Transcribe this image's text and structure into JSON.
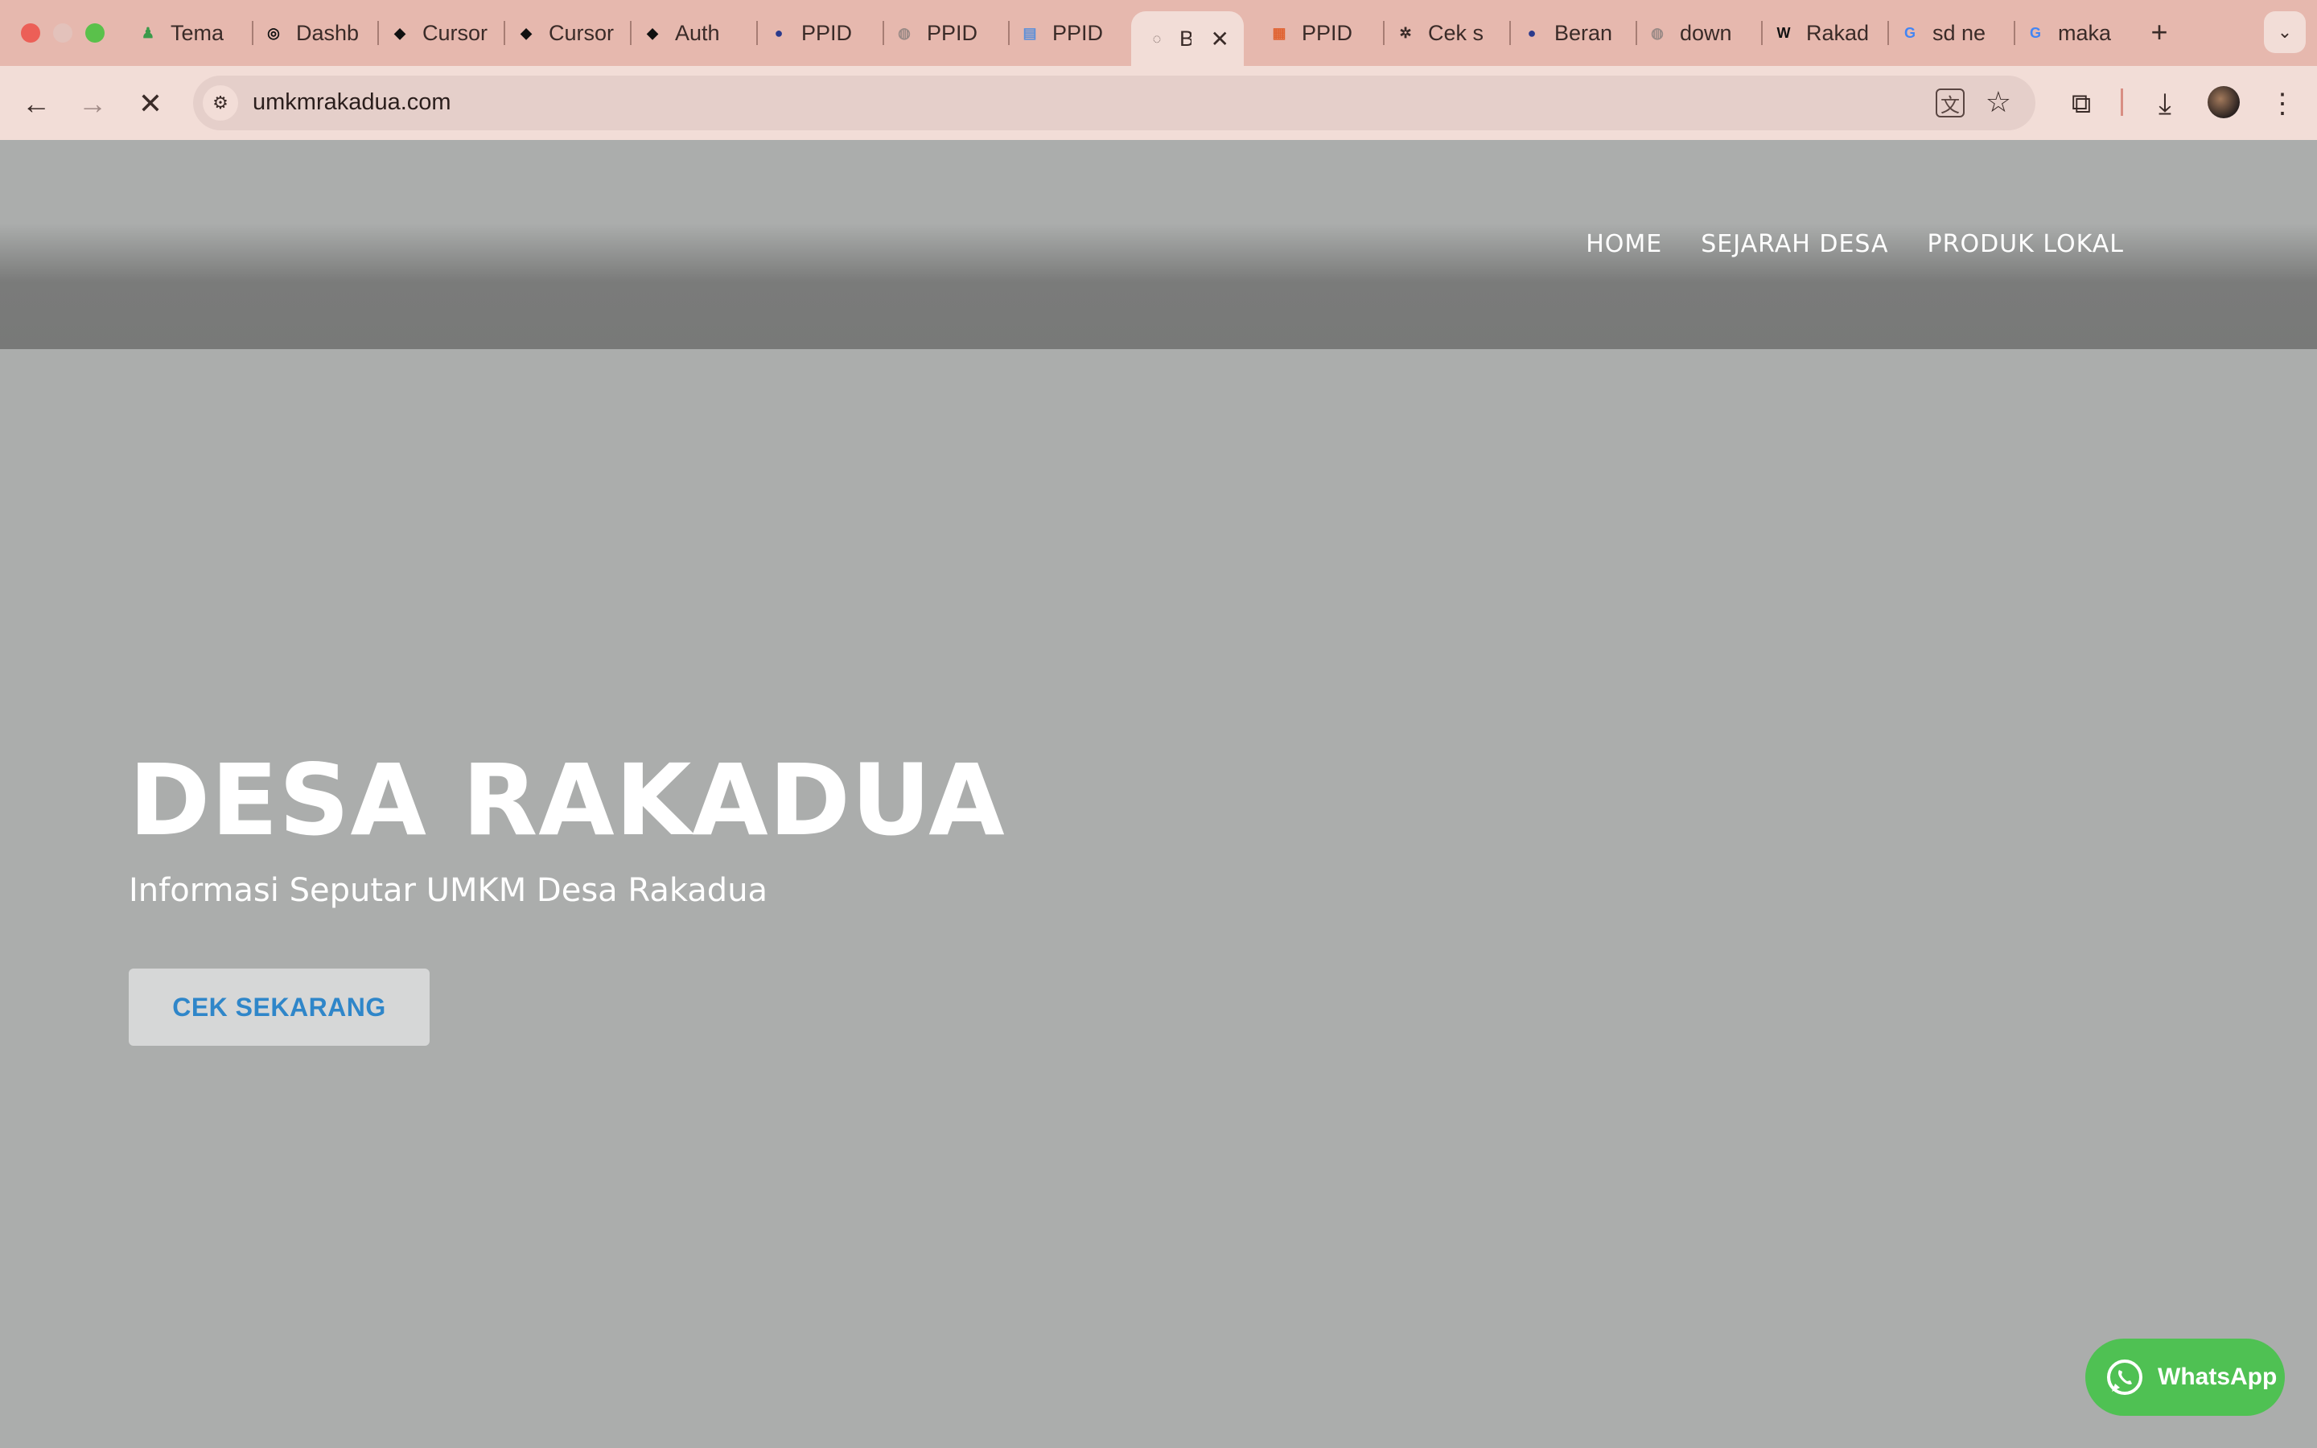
{
  "browser": {
    "tabs": [
      {
        "title": "Tema",
        "favicon": "pawn-icon",
        "color": "#3a9a4a",
        "glyph": "♟"
      },
      {
        "title": "Dashb",
        "favicon": "dashboard-icon",
        "color": "#111111",
        "glyph": "◎"
      },
      {
        "title": "Cursor",
        "favicon": "cursor-icon",
        "color": "#111111",
        "glyph": "◆"
      },
      {
        "title": "Cursor",
        "favicon": "cursor-icon",
        "color": "#111111",
        "glyph": "◆"
      },
      {
        "title": "Auth",
        "favicon": "cursor-icon",
        "color": "#111111",
        "glyph": "◆"
      },
      {
        "title": "PPID",
        "favicon": "ppid-seal-icon",
        "color": "#2b3a8c",
        "glyph": "●"
      },
      {
        "title": "PPID",
        "favicon": "globe-icon",
        "color": "#9a8a86",
        "glyph": "◍"
      },
      {
        "title": "PPID",
        "favicon": "ppid-doc-icon",
        "color": "#5b8fd9",
        "glyph": "▤"
      },
      {
        "title": "B",
        "favicon": "loading-icon",
        "color": "#6b5a56",
        "glyph": "◌",
        "active": true
      },
      {
        "title": "PPID",
        "favicon": "grid-icon",
        "color": "#e0612f",
        "glyph": "▦"
      },
      {
        "title": "Cek s",
        "favicon": "openai-icon",
        "color": "#3a2b28",
        "glyph": "✲"
      },
      {
        "title": "Beran",
        "favicon": "ppid-seal-icon",
        "color": "#2b3a8c",
        "glyph": "●"
      },
      {
        "title": "down",
        "favicon": "globe-icon",
        "color": "#9a8a86",
        "glyph": "◍"
      },
      {
        "title": "Rakad",
        "favicon": "wikipedia-icon",
        "color": "#111111",
        "glyph": "W"
      },
      {
        "title": "sd ne",
        "favicon": "google-icon",
        "color": "#4285f4",
        "glyph": "G"
      },
      {
        "title": "maka",
        "favicon": "google-icon",
        "color": "#4285f4",
        "glyph": "G"
      }
    ],
    "url": "umkmrakadua.com"
  },
  "site": {
    "nav": [
      "HOME",
      "SEJARAH DESA",
      "PRODUK LOKAL"
    ],
    "hero": {
      "title": "DESA RAKADUA",
      "subtitle": "Informasi Seputar UMKM Desa Rakadua",
      "cta": "CEK SEKARANG"
    },
    "whatsapp_label": "WhatsApp"
  },
  "colors": {
    "chrome": "#e6b8ae",
    "toolbar": "#f2ddd7",
    "hero_bg": "#abadac",
    "cta_text": "#2f86c9",
    "whatsapp": "#4fc153"
  }
}
